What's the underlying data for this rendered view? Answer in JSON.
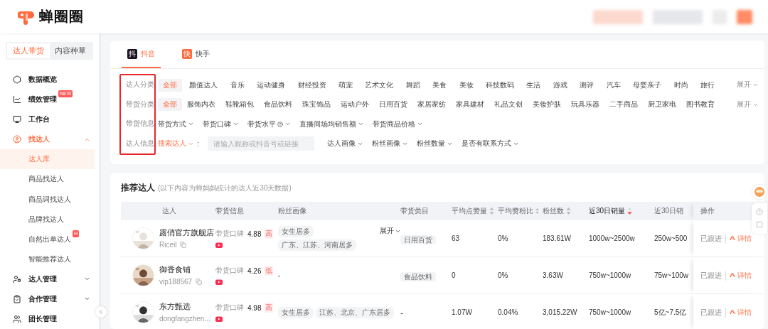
{
  "logo": {
    "name": "蝉圈圈"
  },
  "mode_tabs": [
    {
      "label": "达人带货",
      "selected": true
    },
    {
      "label": "内容种草",
      "selected": false
    }
  ],
  "nav": [
    {
      "label": "数据概览",
      "selected": false
    },
    {
      "label": "绩效管理",
      "badge": "NEW",
      "selected": false
    },
    {
      "label": "工作台",
      "selected": false
    },
    {
      "label": "找达人",
      "selected": true,
      "expanded": true,
      "children": [
        {
          "label": "达人库",
          "selected": true
        },
        {
          "label": "商品找达人",
          "selected": false
        },
        {
          "label": "商品词找达人",
          "selected": false
        },
        {
          "label": "品牌找达人",
          "selected": false
        },
        {
          "label": "自然出单达人",
          "badge": "H",
          "selected": false
        },
        {
          "label": "智能推荐达人",
          "selected": false
        }
      ]
    },
    {
      "label": "达人管理",
      "selected": false,
      "expanded": false
    },
    {
      "label": "合作管理",
      "selected": false,
      "expanded": false
    },
    {
      "label": "团长管理",
      "selected": false
    }
  ],
  "platform_tabs": [
    {
      "label": "抖音",
      "icon": "抖",
      "selected": true
    },
    {
      "label": "快手",
      "icon": "快",
      "selected": false
    }
  ],
  "filters": [
    {
      "label": "达人分类",
      "kind": "chips",
      "more": "展开",
      "options": [
        {
          "label": "全部",
          "selected": true
        },
        {
          "label": "颜值达人",
          "selected": false
        },
        {
          "label": "音乐",
          "selected": false
        },
        {
          "label": "运动健身",
          "selected": false
        },
        {
          "label": "财经投资",
          "selected": false
        },
        {
          "label": "萌宠",
          "selected": false
        },
        {
          "label": "艺术文化",
          "selected": false
        },
        {
          "label": "舞蹈",
          "selected": false
        },
        {
          "label": "美食",
          "selected": false
        },
        {
          "label": "美妆",
          "selected": false
        },
        {
          "label": "科技数码",
          "selected": false
        },
        {
          "label": "生活",
          "selected": false
        },
        {
          "label": "游戏",
          "selected": false
        },
        {
          "label": "测评",
          "selected": false
        },
        {
          "label": "汽车",
          "selected": false
        },
        {
          "label": "母婴亲子",
          "selected": false
        },
        {
          "label": "时尚",
          "selected": false
        },
        {
          "label": "旅行",
          "selected": false
        }
      ]
    },
    {
      "label": "带货分类",
      "kind": "chips",
      "more": "展开",
      "options": [
        {
          "label": "全部",
          "selected": true
        },
        {
          "label": "服饰内衣",
          "selected": false
        },
        {
          "label": "鞋靴箱包",
          "selected": false
        },
        {
          "label": "食品饮料",
          "selected": false
        },
        {
          "label": "珠宝饰品",
          "selected": false
        },
        {
          "label": "运动户外",
          "selected": false
        },
        {
          "label": "日用百货",
          "selected": false
        },
        {
          "label": "家居家纺",
          "selected": false
        },
        {
          "label": "家具建材",
          "selected": false
        },
        {
          "label": "礼品文创",
          "selected": false
        },
        {
          "label": "美妆护肤",
          "selected": false
        },
        {
          "label": "玩具乐器",
          "selected": false
        },
        {
          "label": "二手商品",
          "selected": false
        },
        {
          "label": "厨卫家电",
          "selected": false
        },
        {
          "label": "图书教育",
          "selected": false
        }
      ]
    },
    {
      "label": "带货信息",
      "kind": "dropdowns",
      "options": [
        {
          "label": "带货方式",
          "help": false
        },
        {
          "label": "带货口碑",
          "help": false
        },
        {
          "label": "带货水平",
          "help": true
        },
        {
          "label": "直播间场均销售额",
          "help": false
        },
        {
          "label": "带货商品价格",
          "help": false
        }
      ]
    },
    {
      "label": "达人信息",
      "kind": "search",
      "search_label": "搜索达人",
      "separator": ":",
      "placeholder": "请输入昵称或抖音号或链接",
      "options": [
        {
          "label": "达人画像",
          "help": false
        },
        {
          "label": "粉丝画像",
          "help": false
        },
        {
          "label": "粉丝数量",
          "help": false
        },
        {
          "label": "是否有联系方式",
          "help": false
        }
      ]
    }
  ],
  "table": {
    "title": "推荐达人",
    "note": "(以下内容为蝉妈妈统计的达人近30天数据)",
    "columns": [
      {
        "label": "达人",
        "sortable": false
      },
      {
        "label": "带货信息",
        "sortable": false
      },
      {
        "label": "粉丝画像",
        "sortable": false
      },
      {
        "label": "带货类目",
        "sortable": false
      },
      {
        "label": "平均点赞量",
        "sortable": true,
        "sorted": false
      },
      {
        "label": "平均赞粉比",
        "sortable": true,
        "sorted": false
      },
      {
        "label": "粉丝数",
        "sortable": true,
        "sorted": false
      },
      {
        "label": "近30日销量",
        "sortable": true,
        "sorted": true
      },
      {
        "label": "近30日销",
        "sortable": false
      },
      {
        "label": "操作",
        "sortable": false
      }
    ],
    "rows": [
      {
        "avatar": {
          "kind": "picture"
        },
        "name": "露俏官方旗舰店",
        "handle": "Riceil",
        "score_label": "带货口碑",
        "score": "4.88",
        "score_level": "高",
        "fan_tags": [
          "女生居多",
          "广东、江苏、河南居多"
        ],
        "fan_toggle": "展开",
        "category": {
          "kind": "tag",
          "label": "日用百货"
        },
        "likes": "63",
        "ratio": "0%",
        "fans": "183.61W",
        "sales": "1000w~2500w",
        "revenue": "250w~500",
        "status": "已跟进",
        "detail": "详情"
      },
      {
        "avatar": {
          "kind": "picture"
        },
        "name": "御香食铺",
        "handle": "vip188567",
        "score_label": "带货口碑",
        "score": "4.26",
        "score_level": "低",
        "fan_placeholder": "-",
        "category": {
          "kind": "tag",
          "label": "食品饮料"
        },
        "likes": "0",
        "ratio": "0%",
        "fans": "3.63W",
        "sales": "750w~1000w",
        "revenue": "75w~100w",
        "status": "已跟进",
        "detail": "详情"
      },
      {
        "avatar": {
          "kind": "picture"
        },
        "name": "东方甄选",
        "handle": "dongfangzhen...",
        "score_label": "带货口碑",
        "score": "4.98",
        "score_level": "高",
        "fan_tags": [
          "女生居多",
          "江苏、北京、广东居多"
        ],
        "category": {
          "kind": "text",
          "label": "-"
        },
        "likes": "1.07W",
        "ratio": "0.04%",
        "fans": "3,015.22W",
        "sales": "750w~1000w",
        "revenue": "5亿~7.5亿",
        "status": "已跟进",
        "detail": "详情"
      }
    ]
  }
}
